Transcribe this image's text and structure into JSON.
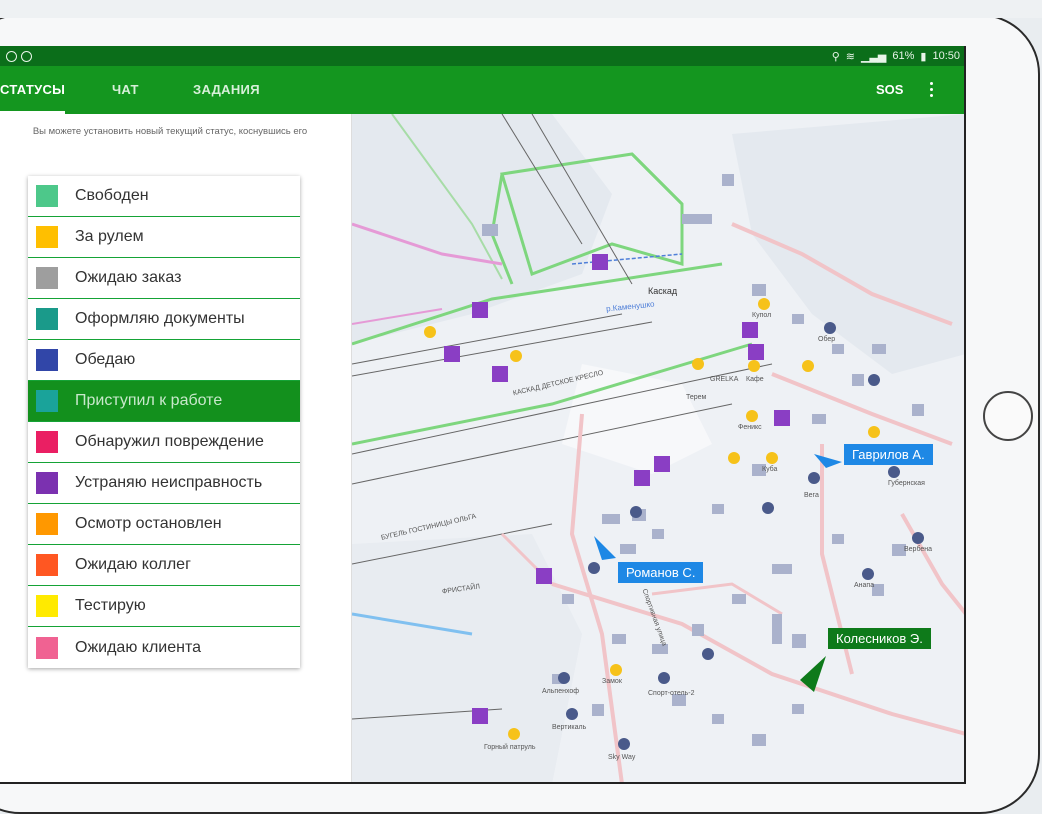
{
  "statusbar": {
    "time": "10:50",
    "battery": "61%"
  },
  "tabs": {
    "statuses": "СТАТУСЫ",
    "chat": "ЧАТ",
    "tasks": "ЗАДАНИЯ"
  },
  "appbar": {
    "sos": "SOS"
  },
  "panel": {
    "hint": "Вы можете установить новый текущий статус, коснувшись его"
  },
  "statuses": [
    {
      "label": "Свободен",
      "color": "#4dc88a",
      "active": false
    },
    {
      "label": "За рулем",
      "color": "#ffbf00",
      "active": false
    },
    {
      "label": "Ожидаю заказ",
      "color": "#9e9e9e",
      "active": false
    },
    {
      "label": "Оформляю документы",
      "color": "#1a9a8a",
      "active": false
    },
    {
      "label": "Обедаю",
      "color": "#3146a8",
      "active": false
    },
    {
      "label": "Приступил к работе",
      "color": "#1aa39a",
      "active": true
    },
    {
      "label": "Обнаружил повреждение",
      "color": "#ea1f63",
      "active": false
    },
    {
      "label": "Устраняю неисправность",
      "color": "#7b31b0",
      "active": false
    },
    {
      "label": "Осмотр остановлен",
      "color": "#ff9800",
      "active": false
    },
    {
      "label": "Ожидаю коллег",
      "color": "#ff5722",
      "active": false
    },
    {
      "label": "Тестирую",
      "color": "#ffea00",
      "active": false
    },
    {
      "label": "Ожидаю клиента",
      "color": "#f06292",
      "active": false
    }
  ],
  "map": {
    "markers": [
      {
        "name": "Гаврилов А.",
        "color": "#1e88e5"
      },
      {
        "name": "Романов С.",
        "color": "#1e88e5"
      },
      {
        "name": "Колесников Э.",
        "color": "#0e7a1a"
      }
    ],
    "labels": {
      "cascade_label": "Каскад",
      "river": "р.Каменушко",
      "cascade_lift": "КАСКАД ДЕТСКОЕ КРЕСЛО",
      "olga_lift": "БУГЕЛЬ ГОСТИНИЦЫ ОЛЬГА",
      "freestyle": "ФРИСТАЙЛ",
      "sport_street": "Спортивная улица",
      "cafe": "Кафе",
      "grelka": "GRELKA",
      "terem": "Терем",
      "feniks": "Феникс",
      "kuba": "Куба",
      "vega": "Вега",
      "gorny": "Горный патруль",
      "sky_way": "Sky Way",
      "alpenhof": "Альпенхоф",
      "vertigal": "Вертикаль",
      "zamok": "Замок",
      "sportotel": "Спорт-отель-2",
      "kupol": "Купол",
      "ober": "Обер",
      "gubernskaya": "Губернская",
      "verbena": "Вербена",
      "anapa": "Анапа"
    }
  }
}
